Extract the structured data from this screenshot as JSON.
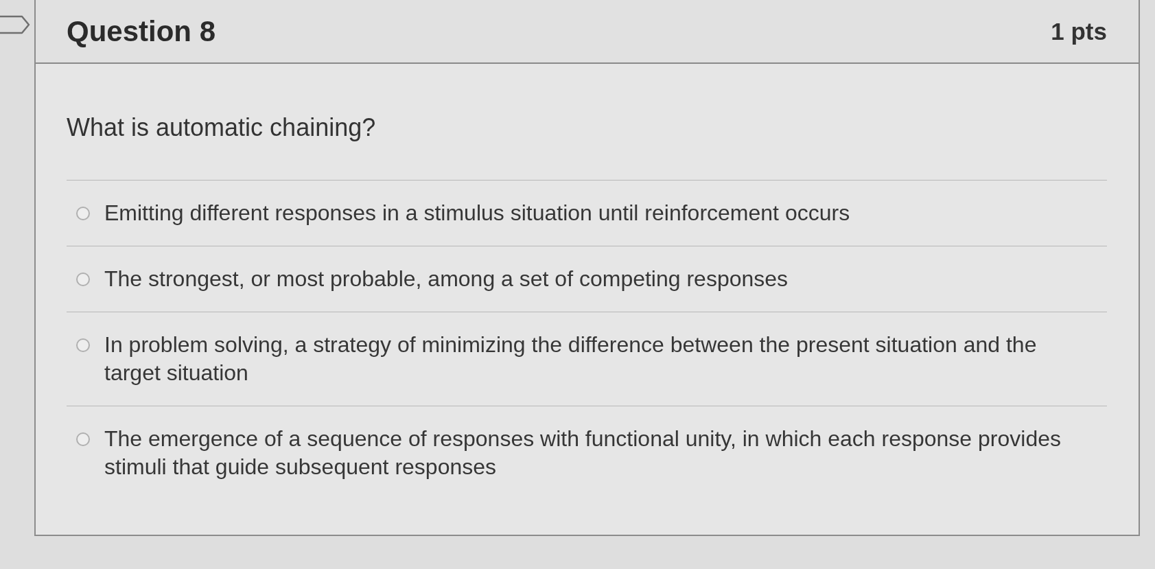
{
  "question": {
    "title": "Question 8",
    "points": "1 pts"
  },
  "prompt": "What is automatic chaining?",
  "answers": [
    {
      "text": "Emitting different responses in a stimulus situation until reinforcement occurs",
      "selected": false
    },
    {
      "text": "The strongest, or most probable, among a set of competing responses",
      "selected": false
    },
    {
      "text": "In problem solving, a strategy of minimizing the difference between the present situation and the target situation",
      "selected": false
    },
    {
      "text": "The emergence of a sequence of responses with functional unity, in which each response provides stimuli that guide subsequent responses",
      "selected": false
    }
  ]
}
